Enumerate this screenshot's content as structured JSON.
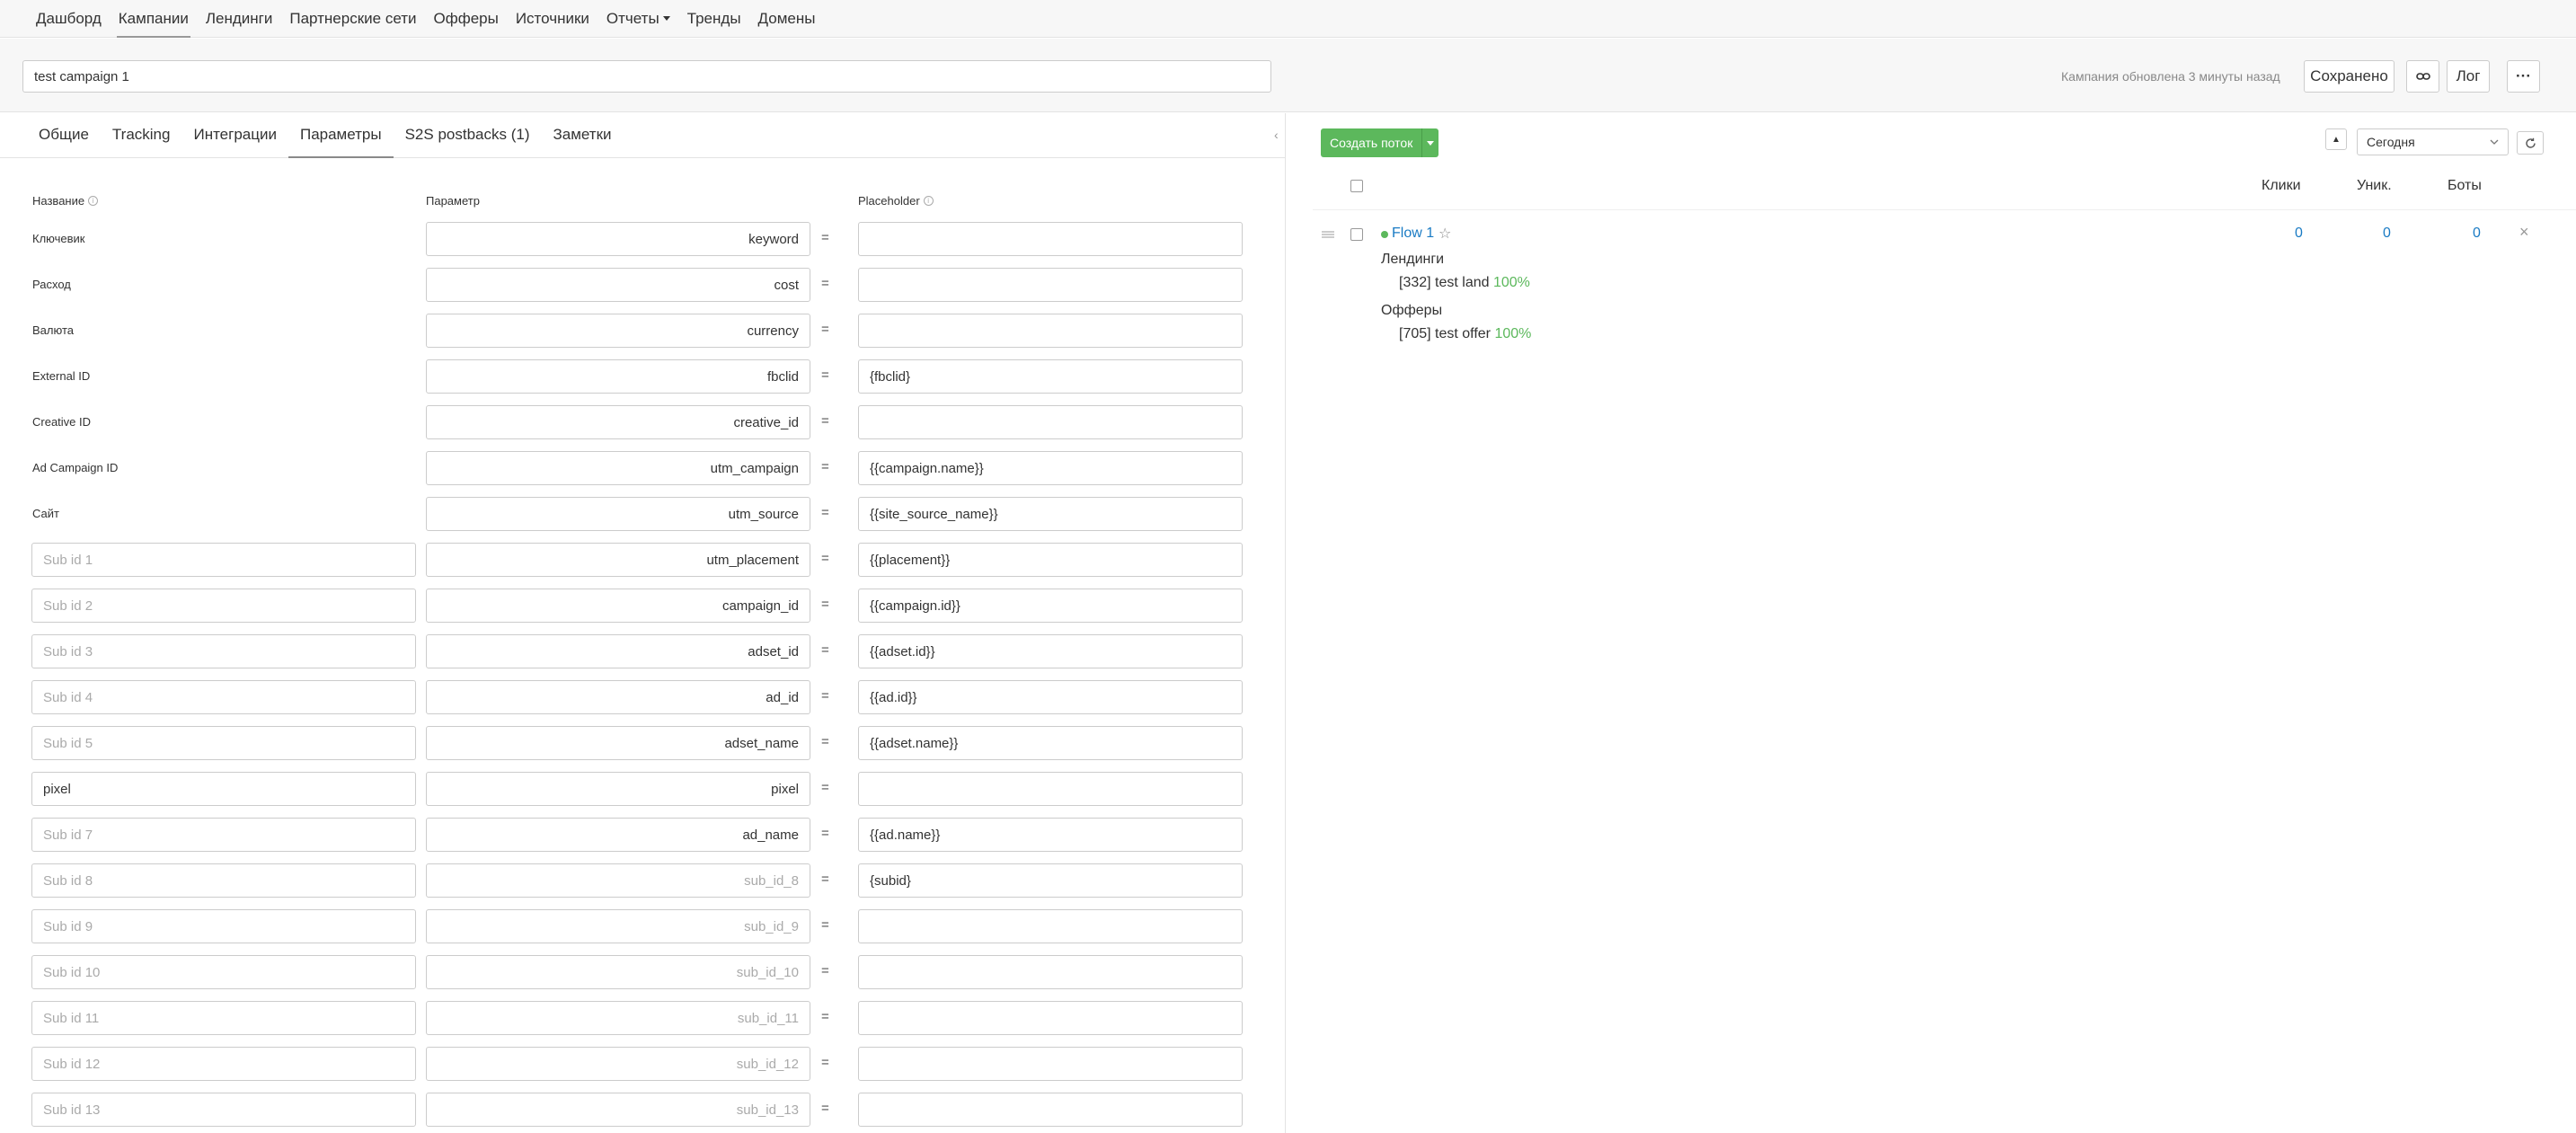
{
  "nav": {
    "items": [
      {
        "label": "Дашборд",
        "active": false
      },
      {
        "label": "Кампании",
        "active": true
      },
      {
        "label": "Лендинги",
        "active": false
      },
      {
        "label": "Партнерские сети",
        "active": false
      },
      {
        "label": "Офферы",
        "active": false
      },
      {
        "label": "Источники",
        "active": false
      },
      {
        "label": "Отчеты",
        "active": false,
        "dropdown": true
      },
      {
        "label": "Тренды",
        "active": false
      },
      {
        "label": "Домены",
        "active": false
      }
    ]
  },
  "header": {
    "campaign_name": "test campaign 1",
    "updated_text": "Кампания обновлена 3 минуты назад",
    "saved_label": "Сохранено",
    "log_label": "Лог",
    "more_label": "···"
  },
  "tabs": [
    {
      "label": "Общие",
      "active": false
    },
    {
      "label": "Tracking",
      "active": false
    },
    {
      "label": "Интеграции",
      "active": false
    },
    {
      "label": "Параметры",
      "active": true
    },
    {
      "label": "S2S postbacks (1)",
      "active": false
    },
    {
      "label": "Заметки",
      "active": false
    }
  ],
  "params": {
    "headers": {
      "name": "Название",
      "param": "Параметр",
      "placeholder": "Placeholder"
    },
    "equals": "=",
    "rows": [
      {
        "label": "Ключевик",
        "param": "keyword",
        "placeholder": ""
      },
      {
        "label": "Расход",
        "param": "cost",
        "placeholder": ""
      },
      {
        "label": "Валюта",
        "param": "currency",
        "placeholder": ""
      },
      {
        "label": "External ID",
        "param": "fbclid",
        "placeholder": "{fbclid}"
      },
      {
        "label": "Creative ID",
        "param": "creative_id",
        "placeholder": ""
      },
      {
        "label": "Ad Campaign ID",
        "param": "utm_campaign",
        "placeholder": "{{campaign.name}}"
      },
      {
        "label": "Сайт",
        "param": "utm_source",
        "placeholder": "{{site_source_name}}"
      },
      {
        "subid": "",
        "subid_placeholder": "Sub id 1",
        "param": "utm_placement",
        "placeholder": "{{placement}}"
      },
      {
        "subid": "",
        "subid_placeholder": "Sub id 2",
        "param": "campaign_id",
        "placeholder": "{{campaign.id}}"
      },
      {
        "subid": "",
        "subid_placeholder": "Sub id 3",
        "param": "adset_id",
        "placeholder": "{{adset.id}}"
      },
      {
        "subid": "",
        "subid_placeholder": "Sub id 4",
        "param": "ad_id",
        "placeholder": "{{ad.id}}"
      },
      {
        "subid": "",
        "subid_placeholder": "Sub id 5",
        "param": "adset_name",
        "placeholder": "{{adset.name}}"
      },
      {
        "subid": "pixel",
        "subid_placeholder": "Sub id 6",
        "param": "pixel",
        "placeholder": ""
      },
      {
        "subid": "",
        "subid_placeholder": "Sub id 7",
        "param": "ad_name",
        "placeholder": "{{ad.name}}"
      },
      {
        "subid": "",
        "subid_placeholder": "Sub id 8",
        "param": "",
        "param_placeholder": "sub_id_8",
        "placeholder": "{subid}"
      },
      {
        "subid": "",
        "subid_placeholder": "Sub id 9",
        "param": "",
        "param_placeholder": "sub_id_9",
        "placeholder": ""
      },
      {
        "subid": "",
        "subid_placeholder": "Sub id 10",
        "param": "",
        "param_placeholder": "sub_id_10",
        "placeholder": ""
      },
      {
        "subid": "",
        "subid_placeholder": "Sub id 11",
        "param": "",
        "param_placeholder": "sub_id_11",
        "placeholder": ""
      },
      {
        "subid": "",
        "subid_placeholder": "Sub id 12",
        "param": "",
        "param_placeholder": "sub_id_12",
        "placeholder": ""
      },
      {
        "subid": "",
        "subid_placeholder": "Sub id 13",
        "param": "",
        "param_placeholder": "sub_id_13",
        "placeholder": ""
      }
    ]
  },
  "flows": {
    "create_label": "Создать поток",
    "period": "Сегодня",
    "columns": {
      "clicks": "Клики",
      "unique": "Уник.",
      "bots": "Боты"
    },
    "items": [
      {
        "name": "Flow 1",
        "clicks": "0",
        "unique": "0",
        "bots": "0",
        "landings_title": "Лендинги",
        "landings": [
          {
            "name": "[332] test land",
            "share": "100%"
          }
        ],
        "offers_title": "Офферы",
        "offers": [
          {
            "name": "[705] test offer",
            "share": "100%"
          }
        ]
      }
    ]
  },
  "colors": {
    "accent_green": "#5cb85c",
    "link_blue": "#1a7bc4"
  }
}
